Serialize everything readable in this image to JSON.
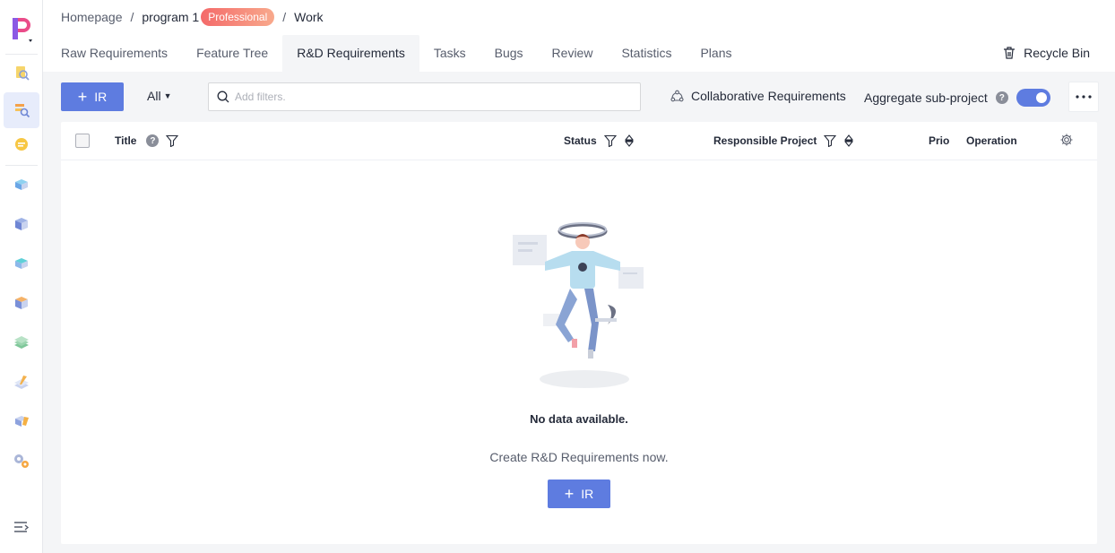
{
  "rail": {
    "icons": [
      "workspace-icon",
      "requirements-icon",
      "code-icon",
      "pipeline-icon",
      "build-icon",
      "deploy-icon",
      "test-icon",
      "artifact-icon",
      "wiki-icon",
      "release-icon",
      "settings-icon"
    ]
  },
  "breadcrumb": {
    "home": "Homepage",
    "project": "program 1",
    "badge": "Professional",
    "current": "Work",
    "separator": "/"
  },
  "tabs": [
    {
      "label": "Raw Requirements"
    },
    {
      "label": "Feature Tree"
    },
    {
      "label": "R&D Requirements",
      "active": true
    },
    {
      "label": "Tasks"
    },
    {
      "label": "Bugs"
    },
    {
      "label": "Review"
    },
    {
      "label": "Statistics"
    },
    {
      "label": "Plans"
    }
  ],
  "recycle_bin": "Recycle Bin",
  "toolbar": {
    "add_ir": "IR",
    "all_filter": "All",
    "search_placeholder": "Add filters.",
    "collaborative": "Collaborative Requirements",
    "aggregate": "Aggregate sub-project",
    "aggregate_on": true
  },
  "table": {
    "columns": {
      "title": "Title",
      "status": "Status",
      "responsible_project": "Responsible Project",
      "prio": "Prio",
      "operation": "Operation"
    }
  },
  "empty": {
    "title": "No data available.",
    "subtitle": "Create R&D Requirements now.",
    "button": "IR"
  },
  "colors": {
    "primary": "#5e7ce0",
    "badge_start": "#f46a6a",
    "badge_end": "#f8a98c",
    "background": "#f4f5f7"
  }
}
